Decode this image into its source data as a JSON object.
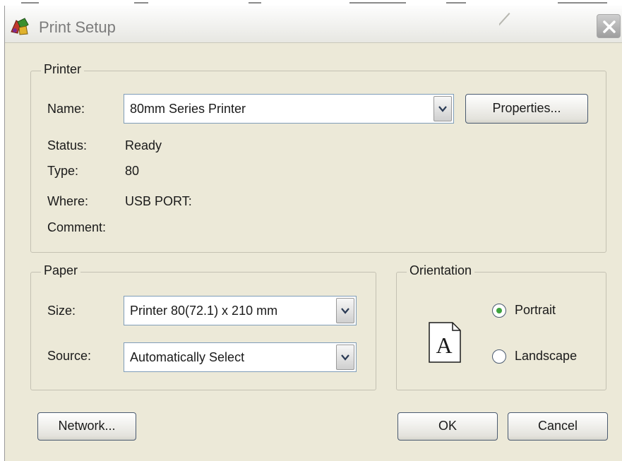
{
  "window": {
    "title": "Print Setup",
    "icon": "printer-app-icon",
    "close_icon": "close-icon"
  },
  "printer": {
    "group_label": "Printer",
    "name_label": "Name:",
    "name_value": "80mm Series Printer",
    "properties_button": "Properties...",
    "status_label": "Status:",
    "status_value": "Ready",
    "type_label": "Type:",
    "type_value": "80",
    "where_label": "Where:",
    "where_value": "USB PORT:",
    "comment_label": "Comment:",
    "comment_value": ""
  },
  "paper": {
    "group_label": "Paper",
    "size_label": "Size:",
    "size_value": "Printer 80(72.1) x 210 mm",
    "source_label": "Source:",
    "source_value": "Automatically Select"
  },
  "orientation": {
    "group_label": "Orientation",
    "preview_letter": "A",
    "options": [
      {
        "label": "Portrait",
        "checked": true
      },
      {
        "label": "Landscape",
        "checked": false
      }
    ]
  },
  "buttons": {
    "network": "Network...",
    "ok": "OK",
    "cancel": "Cancel"
  },
  "colors": {
    "dialog_bg": "#ece9d8",
    "radio_selected": "#3ea33e",
    "combo_border": "#7f9db9"
  }
}
